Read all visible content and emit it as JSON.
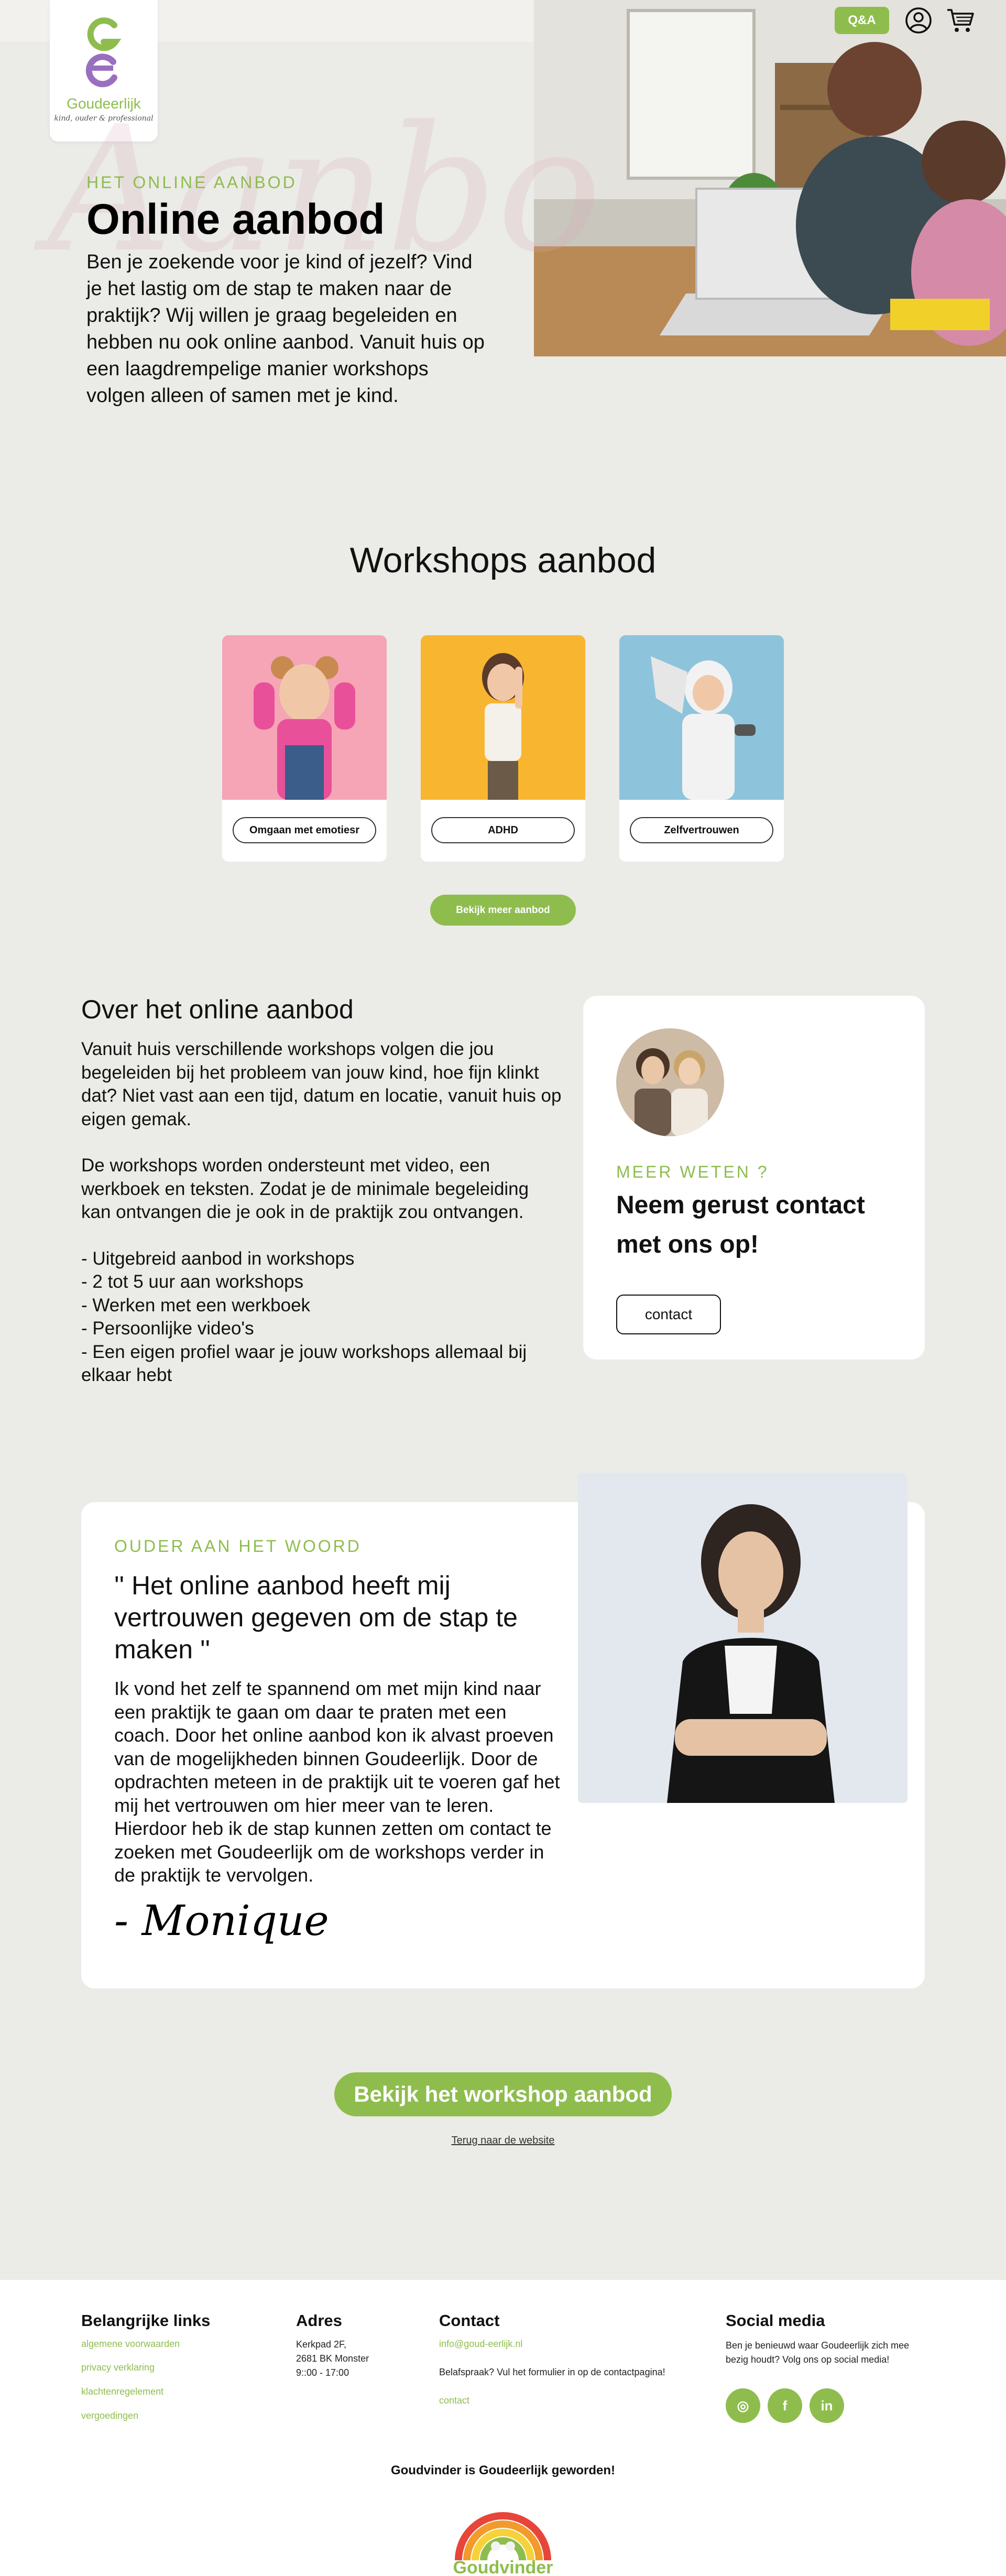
{
  "header": {
    "logo_name": "Goudeerlijk",
    "logo_tagline": "kind, ouder & professional",
    "qa_label": "Q&A",
    "account_icon": "user-icon",
    "cart_icon": "cart-icon"
  },
  "hero": {
    "watermark": "Aanbo",
    "kicker": "HET ONLINE AANBOD",
    "title": "Online aanbod",
    "text": "Ben je zoekende voor je kind of jezelf? Vind je het lastig om de stap te maken naar de praktijk? Wij willen je graag begeleiden en hebben nu ook online aanbod. Vanuit huis op een laagdrempelige manier workshops volgen alleen of samen met je kind."
  },
  "workshops": {
    "title": "Workshops aanbod",
    "items": [
      {
        "label": "Omgaan met emotiesr"
      },
      {
        "label": "ADHD"
      },
      {
        "label": "Zelfvertrouwen"
      }
    ],
    "more_label": "Bekijk meer aanbod"
  },
  "about": {
    "title": "Over het online aanbod",
    "paragraph1": "Vanuit huis verschillende workshops volgen die jou begeleiden bij het probleem van jouw kind, hoe fijn klinkt dat? Niet vast aan een tijd, datum en locatie, vanuit huis op eigen gemak.",
    "paragraph2": "De workshops worden ondersteunt met video, een werkboek en teksten. Zodat je de minimale begeleiding kan ontvangen die je ook in de praktijk zou ontvangen.",
    "bullets": [
      "- Uitgebreid aanbod in workshops",
      "- 2 tot 5 uur aan workshops",
      "- Werken met een werkboek",
      "- Persoonlijke video's",
      "- Een eigen profiel waar je jouw workshops allemaal bij elkaar hebt"
    ]
  },
  "contact_card": {
    "kicker": "MEER WETEN ?",
    "title": "Neem gerust contact met ons op!",
    "button_label": "contact"
  },
  "testimonial": {
    "kicker": "OUDER AAN HET WOORD",
    "quote": "'' Het online aanbod heeft mij vertrouwen gegeven om de stap te maken ''",
    "body": "Ik vond het zelf te spannend om met mijn kind naar een praktijk te gaan om daar te praten met een coach. Door het online aanbod kon ik alvast proeven van de mogelijkheden binnen Goudeerlijk. Door de opdrachten meteen in de praktijk uit te voeren gaf het mij het vertrouwen om hier meer van te leren. Hierdoor heb ik de stap kunnen zetten om contact te zoeken met Goudeerlijk om de workshops verder in de praktijk te vervolgen.",
    "signature": "- Monique"
  },
  "cta": {
    "button_label": "Bekijk het workshop aanbod",
    "back_link": "Terug naar de website"
  },
  "footer": {
    "links_title": "Belangrijke links",
    "links": [
      "algemene voorwaarden",
      "privacy verklaring",
      "klachtenregelement",
      "vergoedingen"
    ],
    "address_title": "Adres",
    "address_lines": [
      "Kerkpad 2F,",
      "2681 BK Monster",
      "9::00 - 17:00"
    ],
    "contact_title": "Contact",
    "contact_email": "info@goud-eerlijk.nl",
    "contact_text": "Belafspraak? Vul het formulier in op de contactpagina!",
    "contact_link": "contact",
    "social_title": "Social media",
    "social_text": "Ben je benieuwd waar Goudeerlijk zich mee bezig houdt? Volg ons op social media!",
    "social_icons": [
      "instagram-icon",
      "facebook-icon",
      "linkedin-icon"
    ],
    "social_glyphs": [
      "◎",
      "f",
      "in"
    ],
    "note": "Goudvinder is Goudeerlijk geworden!",
    "partner_logo_text": "Goudvinder"
  },
  "colors": {
    "accent": "#8ebd4e",
    "background": "#ebebe7",
    "card": "#ffffff"
  }
}
